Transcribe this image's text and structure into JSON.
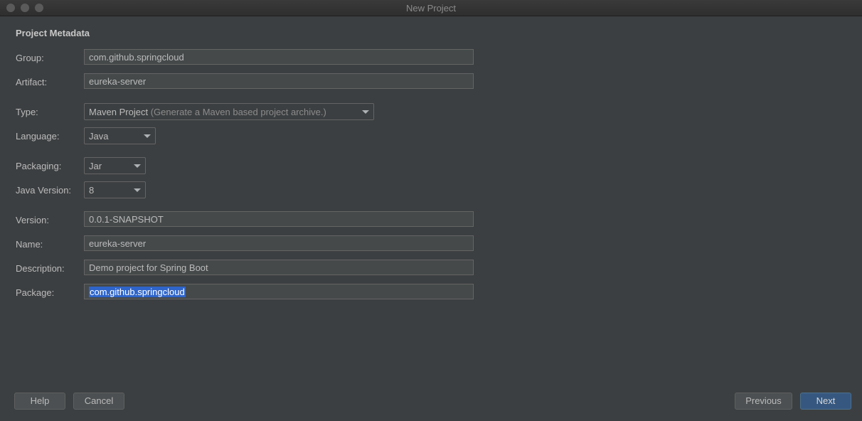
{
  "window": {
    "title": "New Project"
  },
  "section_title": "Project Metadata",
  "fields": {
    "group": {
      "label": "Group:",
      "value": "com.github.springcloud"
    },
    "artifact": {
      "label": "Artifact:",
      "value": "eureka-server"
    },
    "version": {
      "label": "Version:",
      "value": "0.0.1-SNAPSHOT"
    },
    "name": {
      "label": "Name:",
      "value": "eureka-server"
    },
    "description": {
      "label": "Description:",
      "value": "Demo project for Spring Boot"
    },
    "package": {
      "label": "Package:",
      "value": "com.github.springcloud"
    }
  },
  "selects": {
    "type": {
      "label": "Type:",
      "value": "Maven Project",
      "hint": "(Generate a Maven based project archive.)"
    },
    "language": {
      "label": "Language:",
      "value": "Java"
    },
    "packaging": {
      "label": "Packaging:",
      "value": "Jar"
    },
    "java_version": {
      "label": "Java Version:",
      "value": "8"
    }
  },
  "buttons": {
    "help": "Help",
    "cancel": "Cancel",
    "previous": "Previous",
    "next": "Next"
  },
  "colors": {
    "background": "#3c3f41",
    "field_bg": "#45494a",
    "selection": "#2f65ca",
    "primary_button": "#365880"
  }
}
